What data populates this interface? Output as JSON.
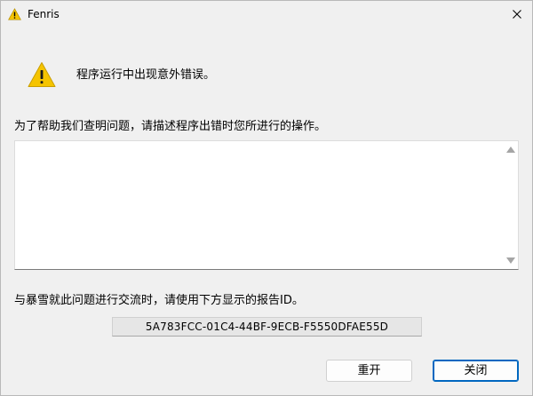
{
  "window": {
    "title": "Fenris"
  },
  "message": {
    "main": "程序运行中出现意外错误。",
    "describe_prompt": "为了帮助我们查明问题，请描述程序出错时您所进行的操作。",
    "description_value": "",
    "contact_prompt": "与暴雪就此问题进行交流时，请使用下方显示的报告ID。",
    "report_id": "5A783FCC-01C4-44BF-9ECB-F5550DFAE55D"
  },
  "buttons": {
    "restart_label": "重开",
    "close_label": "关闭"
  },
  "icons": {
    "title": "warning-icon",
    "main": "warning-icon",
    "close": "close-icon"
  },
  "colors": {
    "warning_yellow": "#f5c400",
    "focus_blue": "#0067c0"
  }
}
